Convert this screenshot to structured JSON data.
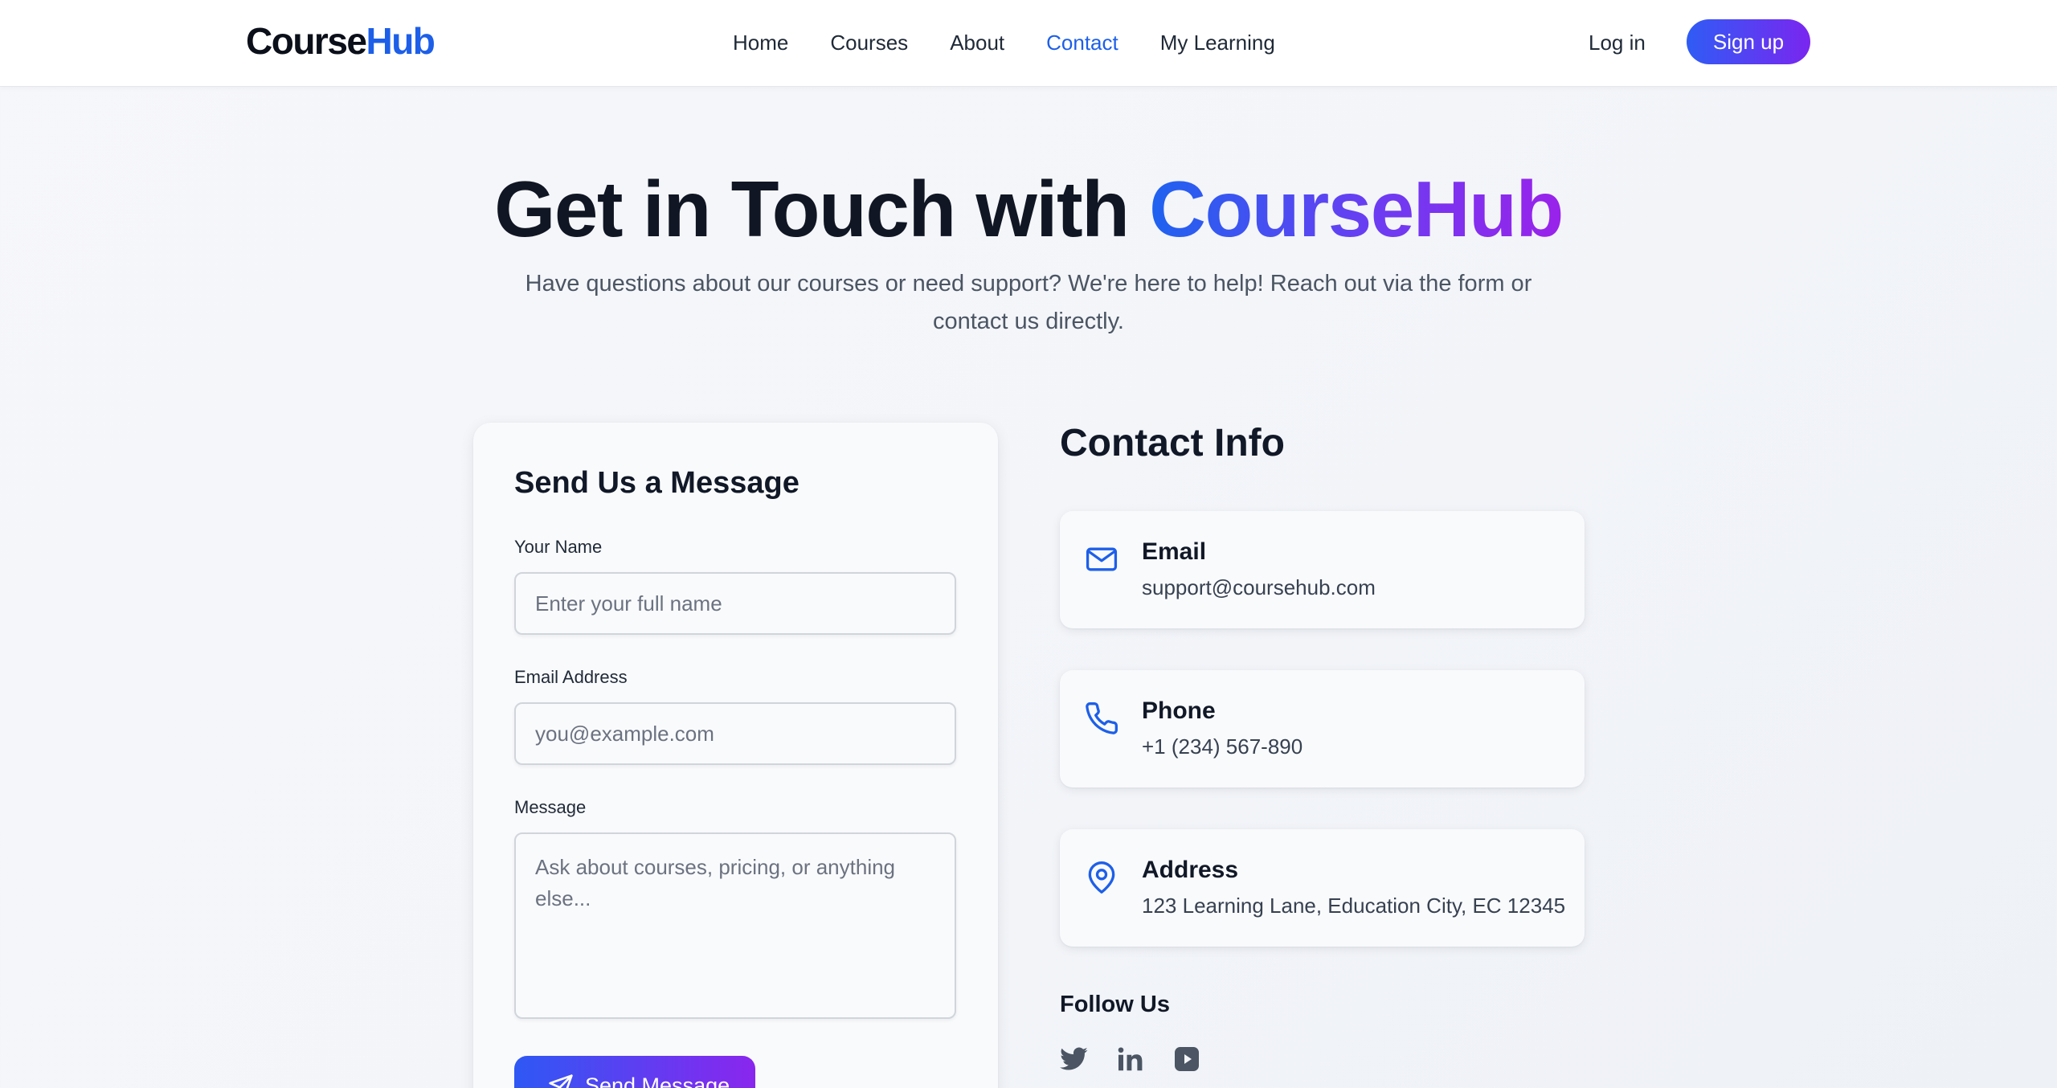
{
  "header": {
    "logo_part1": "Course",
    "logo_part2": "Hub",
    "nav": [
      "Home",
      "Courses",
      "About",
      "Contact",
      "My Learning"
    ],
    "active_nav": "Contact",
    "login_label": "Log in",
    "signup_label": "Sign up"
  },
  "hero": {
    "title_plain": "Get in Touch with ",
    "title_brand": "CourseHub",
    "subtitle": "Have questions about our courses or need support? We're here to help! Reach out via the form or contact us directly."
  },
  "form": {
    "title": "Send Us a Message",
    "name_label": "Your Name",
    "name_placeholder": "Enter your full name",
    "email_label": "Email Address",
    "email_placeholder": "you@example.com",
    "message_label": "Message",
    "message_placeholder": "Ask about courses, pricing, or anything else...",
    "submit_label": "Send Message"
  },
  "contact_info": {
    "title": "Contact Info",
    "items": [
      {
        "icon": "mail-icon",
        "label": "Email",
        "value": "support@coursehub.com"
      },
      {
        "icon": "phone-icon",
        "label": "Phone",
        "value": "+1 (234) 567-890"
      },
      {
        "icon": "map-pin-icon",
        "label": "Address",
        "value": "123 Learning Lane, Education City, EC 12345"
      }
    ],
    "follow_title": "Follow Us",
    "socials": [
      "twitter-icon",
      "linkedin-icon",
      "youtube-icon"
    ]
  },
  "colors": {
    "accent": "#1d5fe8",
    "gradient_start": "#2f5cf5",
    "gradient_end": "#8a26ee",
    "social_icon": "#4b5563"
  }
}
